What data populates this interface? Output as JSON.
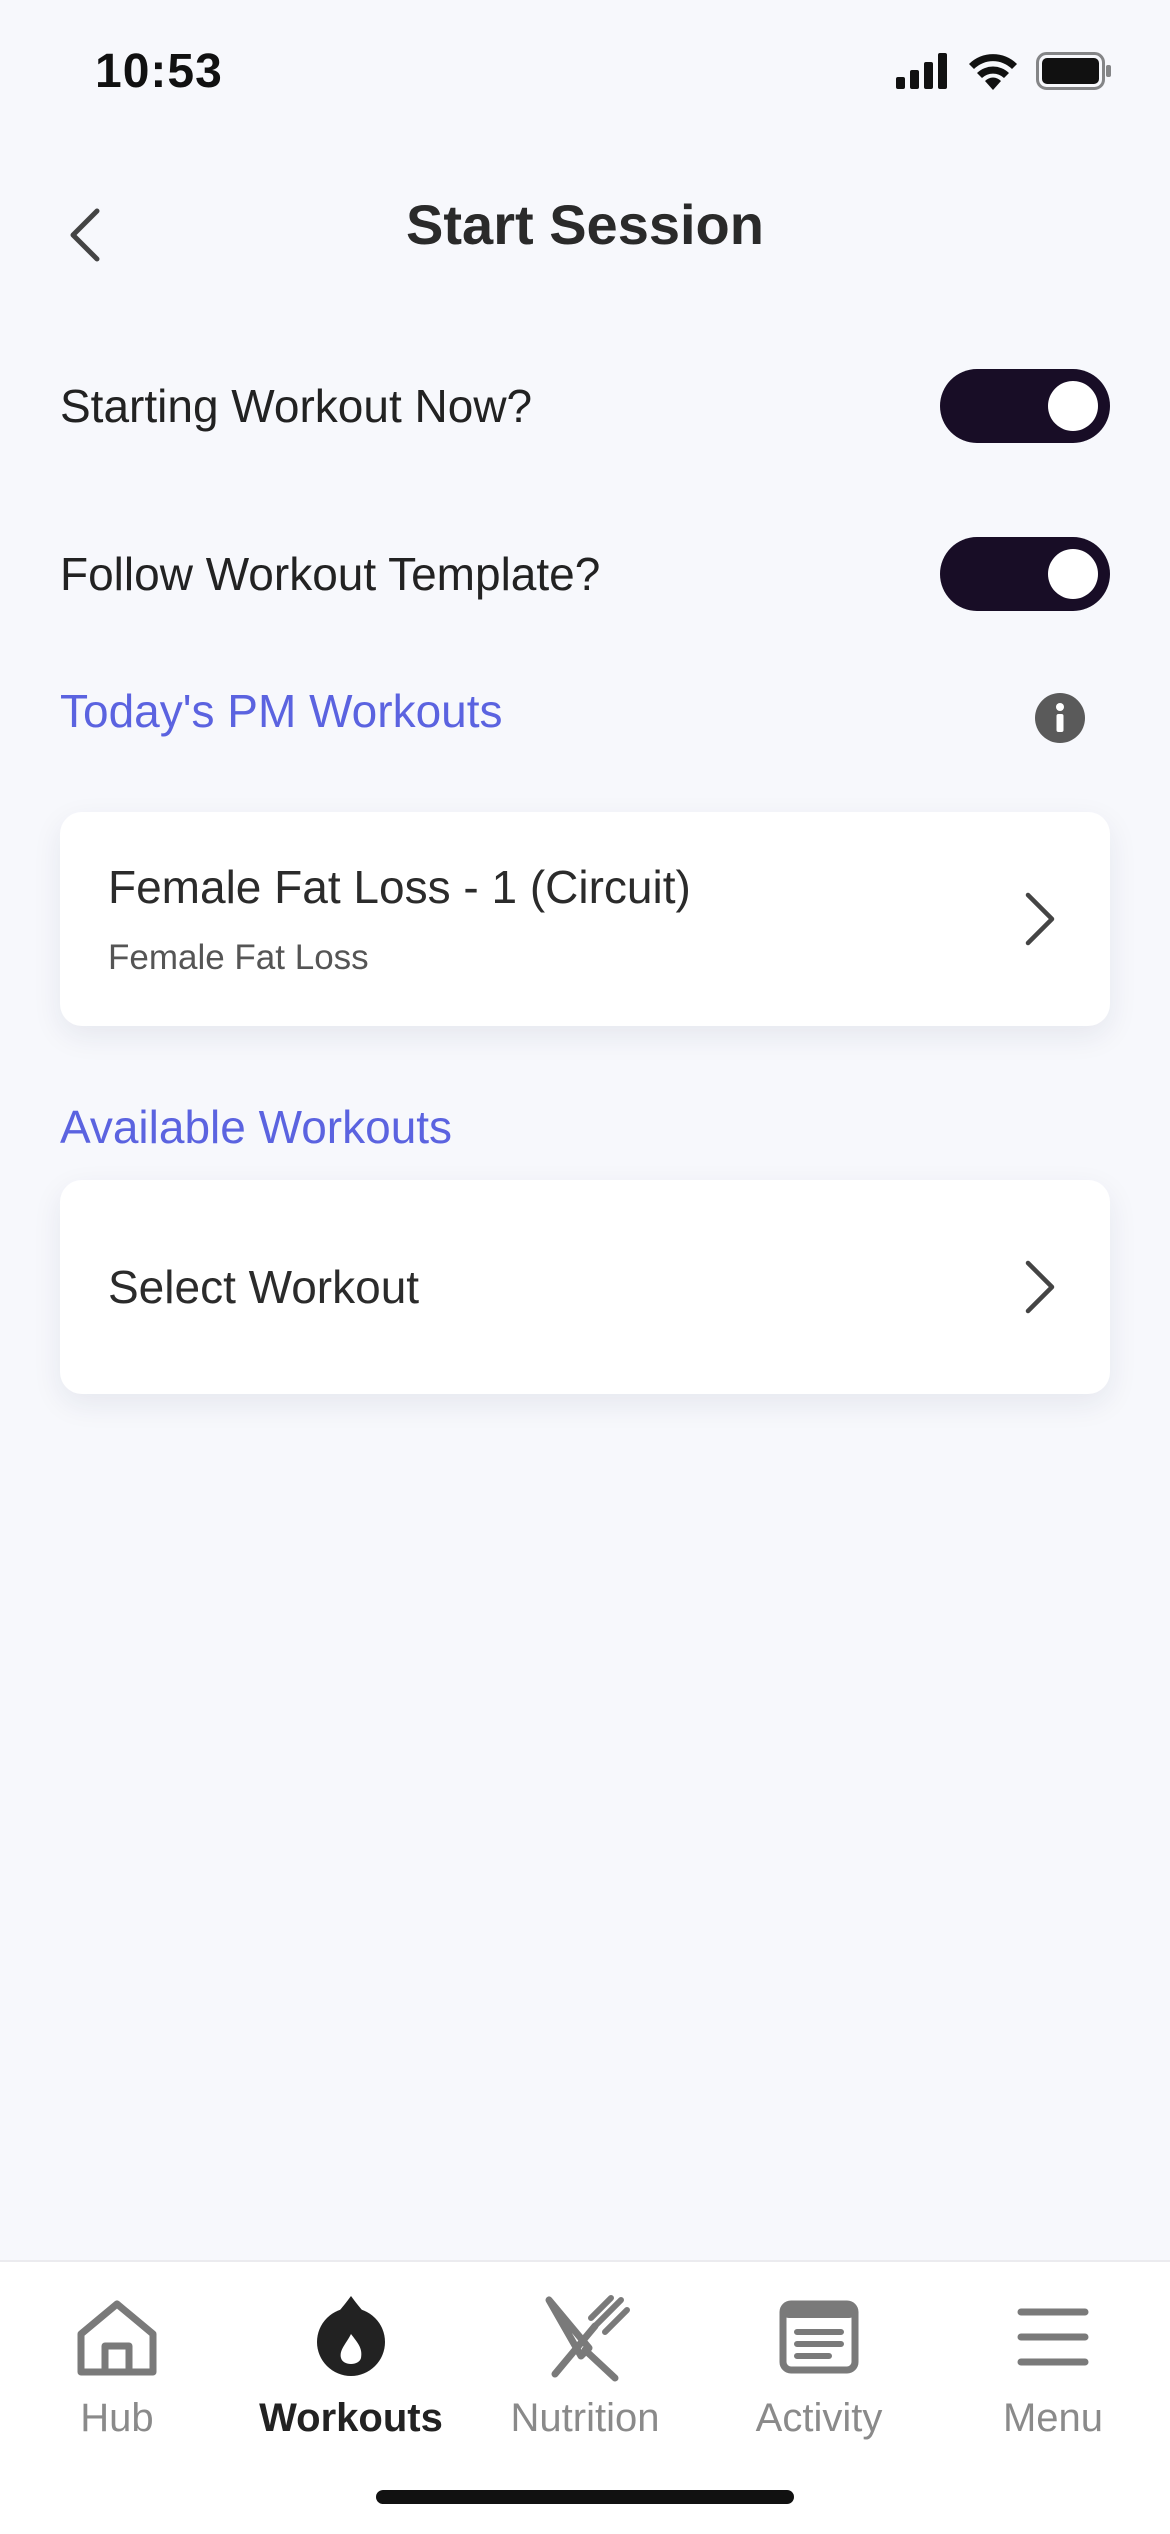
{
  "status": {
    "time": "10:53"
  },
  "header": {
    "title": "Start Session"
  },
  "settings": [
    {
      "label": "Starting Workout Now?",
      "on": true
    },
    {
      "label": "Follow Workout Template?",
      "on": true
    }
  ],
  "sections": {
    "todays": "Today's PM Workouts",
    "available": "Available Workouts"
  },
  "todays_workout": {
    "title": "Female Fat Loss - 1 (Circuit)",
    "subtitle": "Female Fat Loss"
  },
  "select_workout": {
    "label": "Select Workout"
  },
  "tabs": [
    {
      "label": "Hub",
      "icon": "home-icon"
    },
    {
      "label": "Workouts",
      "icon": "flame-icon",
      "active": true
    },
    {
      "label": "Nutrition",
      "icon": "utensils-icon"
    },
    {
      "label": "Activity",
      "icon": "newspaper-icon"
    },
    {
      "label": "Menu",
      "icon": "hamburger-icon"
    }
  ],
  "colors": {
    "accent": "#5b63e0",
    "toggle": "#180d26",
    "background": "#f7f8fc"
  }
}
